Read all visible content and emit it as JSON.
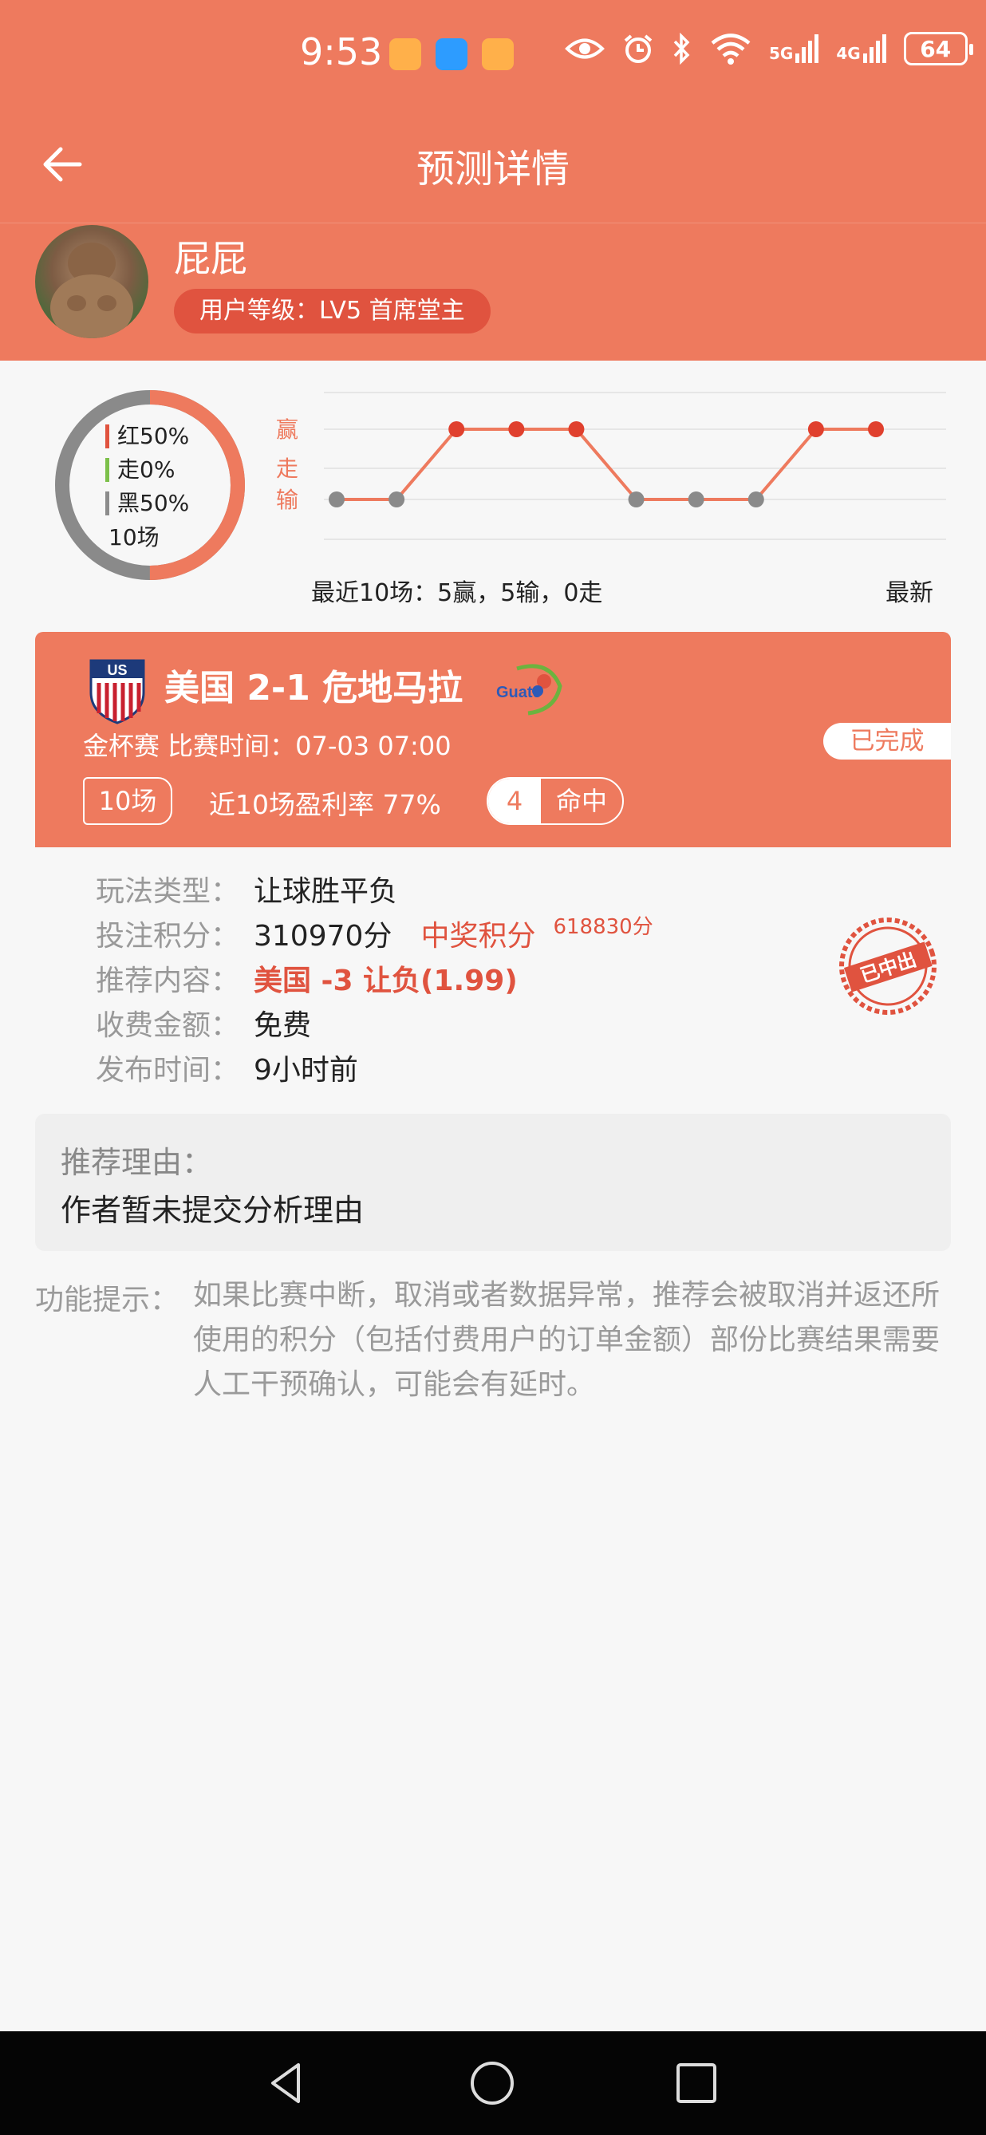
{
  "status_bar": {
    "time": "9:53",
    "signal_5g": "5G",
    "signal_4g": "4G",
    "battery": "64"
  },
  "header": {
    "title": "预测详情"
  },
  "user": {
    "name": "屁屁",
    "level": "用户等级：LV5 首席堂主"
  },
  "stats": {
    "legend": [
      {
        "label": "红50%",
        "color": "#e0533f"
      },
      {
        "label": "走0%",
        "color": "#7cc04a"
      },
      {
        "label": "黑50%",
        "color": "#8c8c8c"
      }
    ],
    "count": "10场",
    "red_fraction": 0.5,
    "black_fraction": 0.5
  },
  "chart_data": {
    "type": "line",
    "y_categories": [
      "赢",
      "走",
      "输"
    ],
    "y_values": [
      "输",
      "输",
      "赢",
      "赢",
      "赢",
      "输",
      "输",
      "输",
      "赢",
      "赢"
    ],
    "caption": "最近10场：5赢，5输，0走",
    "latest_label": "最新",
    "line_color": "#ee7a5e",
    "win_color": "#e0402e",
    "loss_color": "#8a8a8a"
  },
  "match": {
    "title": "美国 2-1 危地马拉",
    "meta": "金杯赛 比赛时间：07-03 07:00",
    "status": "已完成",
    "recent_count": "10场",
    "win_rate": "近10场盈利率 77%",
    "hit_number": "4",
    "hit_label": "命中",
    "crest_us_text": "US",
    "crest_guate_text": "Guate"
  },
  "details": {
    "play_type_label": "玩法类型：",
    "play_type": "让球胜平负",
    "bet_points_label": "投注积分：",
    "bet_points": "310970分",
    "prize_label": "中奖积分",
    "prize_points": "618830分",
    "content_label": "推荐内容：",
    "content": "美国 -3 让负(1.99)",
    "fee_label": "收费金额：",
    "fee": "免费",
    "publish_label": "发布时间：",
    "publish_time": "9小时前",
    "stamp_text": "已中出"
  },
  "reason": {
    "label": "推荐理由：",
    "text": "作者暂未提交分析理由"
  },
  "tip": {
    "label": "功能提示：",
    "text": "如果比赛中断，取消或者数据异常，推荐会被取消并返还所使用的积分（包括付费用户的订单金额）部份比赛结果需要人工干预确认，可能会有延时。"
  },
  "colors": {
    "brand": "#ee7a5e",
    "accent": "#e0533f"
  }
}
